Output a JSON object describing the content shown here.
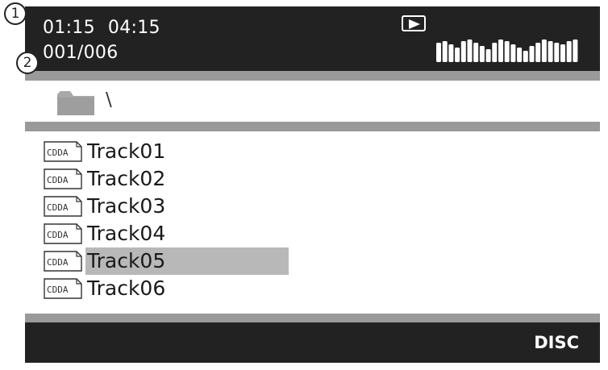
{
  "callouts": [
    "1",
    "2"
  ],
  "status": {
    "elapsed_time": "01:15",
    "total_time": "04:15",
    "track_counter": "001/006",
    "play_state_icon": "play-icon",
    "level_meter_icon": "level-meter-icon"
  },
  "folder": {
    "icon": "folder-icon",
    "path": "\\"
  },
  "tracks": [
    {
      "type": "CDDA",
      "name": "Track01",
      "selected": false
    },
    {
      "type": "CDDA",
      "name": "Track02",
      "selected": false
    },
    {
      "type": "CDDA",
      "name": "Track03",
      "selected": false
    },
    {
      "type": "CDDA",
      "name": "Track04",
      "selected": false
    },
    {
      "type": "CDDA",
      "name": "Track05",
      "selected": true
    },
    {
      "type": "CDDA",
      "name": "Track06",
      "selected": false
    }
  ],
  "source_label": "DISC",
  "colors": {
    "screen_bg": "#222222",
    "band": "#9a9a9a",
    "selection": "#b8b8b8",
    "text_light": "#ffffff"
  }
}
